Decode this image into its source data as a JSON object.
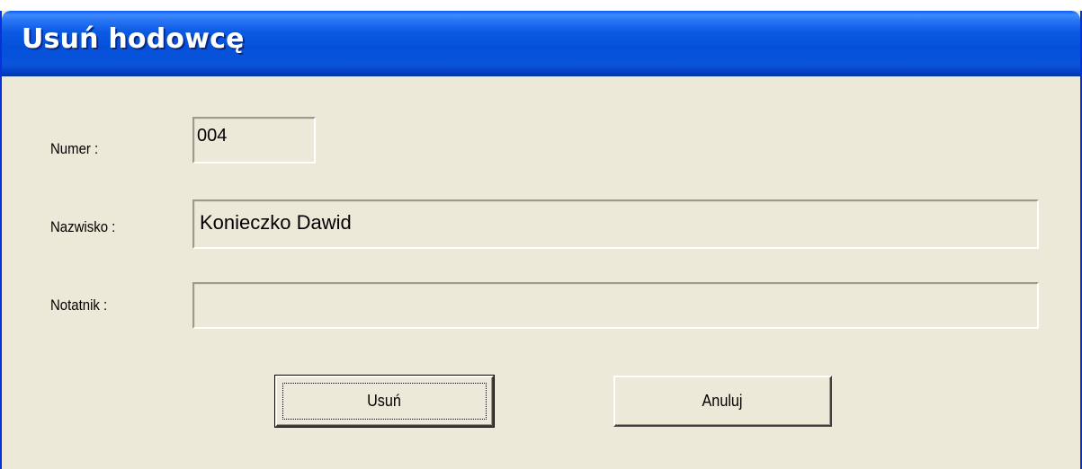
{
  "window": {
    "title": "Usuń hodowcę"
  },
  "form": {
    "numer": {
      "label": "Numer :",
      "value": "004"
    },
    "nazwisko": {
      "label": "Nazwisko :",
      "value": "Konieczko Dawid"
    },
    "notatnik": {
      "label": "Notatnik :",
      "value": ""
    }
  },
  "buttons": {
    "delete_label": "Usuń",
    "cancel_label": "Anuluj"
  },
  "colors": {
    "title_bar": "#0550d8",
    "dialog_face": "#ece9d8",
    "title_text": "#ffffff"
  }
}
